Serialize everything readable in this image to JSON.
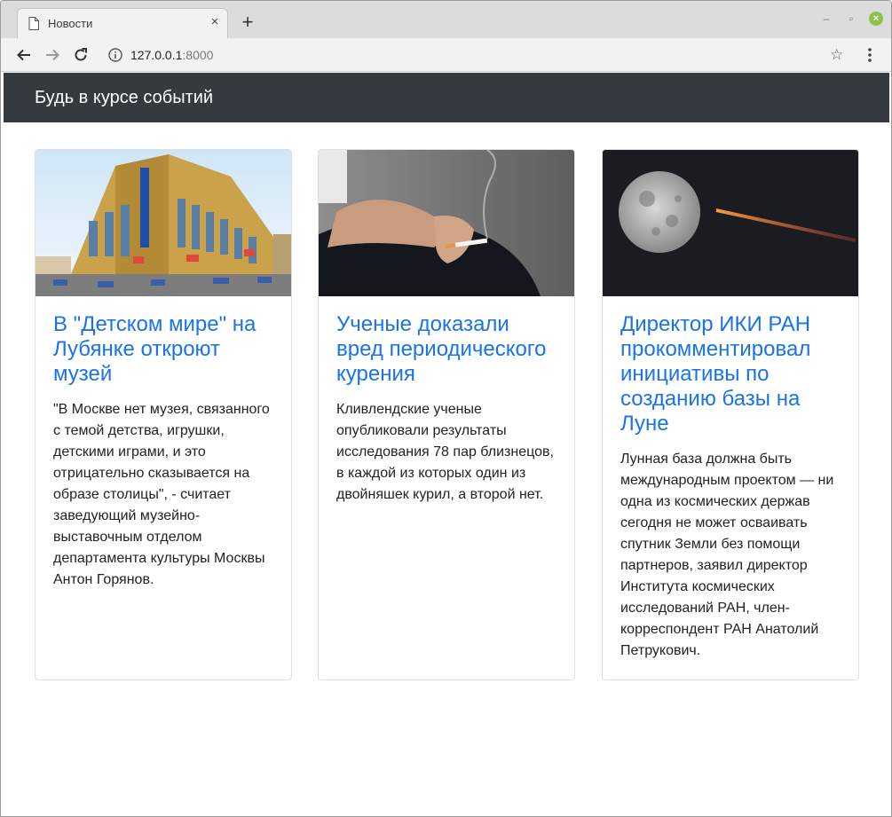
{
  "browser": {
    "tab_title": "Новости",
    "tab_close_glyph": "×",
    "new_tab_glyph": "+",
    "url_host": "127.0.0.1",
    "url_port": ":8000",
    "star_glyph": "☆",
    "window_controls": {
      "minimize": "–",
      "restore": "▫",
      "close": "×"
    }
  },
  "navbar": {
    "brand": "Будь в курсе событий",
    "background": "#343a40"
  },
  "accent_color": "#1a73e8",
  "cards": [
    {
      "title": "В \"Детском мире\" на Лубянке откроют музей",
      "text": "\"В Москве нет музея, связанного с темой детства, игрушки, детскими играми, и это отрицательно сказывается на образе столицы\", - считает заведующий музейно-выставочным отделом департамента культуры Москвы Антон Горянов.",
      "image": "building-photo"
    },
    {
      "title": "Ученые доказали вред периодического курения",
      "text": "Кливлендские ученые опубликовали результаты исследования 78 пар близнецов, в каждой из которых один из двойняшек курил, а второй нет.",
      "image": "cigarette-photo"
    },
    {
      "title": "Директор ИКИ РАН прокомментировал инициативы по созданию базы на Луне",
      "text": "Лунная база должна быть международным проектом — ни одна из космических держав сегодня не может осваивать спутник Земли без помощи партнеров, заявил директор Института космических исследований РАН, член-корреспондент РАН Анатолий Петрукович.",
      "image": "moon-photo"
    }
  ]
}
